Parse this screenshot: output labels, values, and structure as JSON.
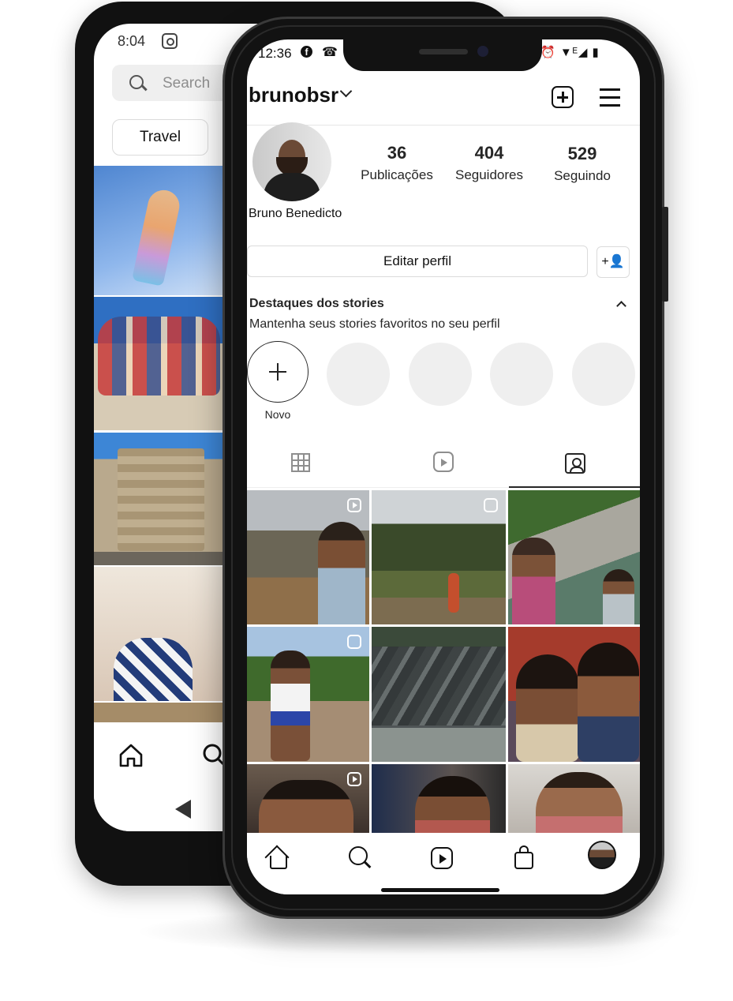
{
  "back_phone": {
    "time": "8:04",
    "search_placeholder": "Search",
    "chip_label": "Travel"
  },
  "status_bar": {
    "time": "12:36",
    "fb_glyph": "f",
    "right": "⏰ ▼ᴱ◢ ▮"
  },
  "profile": {
    "username": "brunobsr",
    "full_name": "Bruno Benedicto",
    "stats": [
      {
        "value": "36",
        "label": "Publicações"
      },
      {
        "value": "404",
        "label": "Seguidores"
      },
      {
        "value": "529",
        "label": "Seguindo"
      }
    ],
    "edit_label": "Editar perfil",
    "suggest_glyph": "+👤"
  },
  "highlights": {
    "title": "Destaques dos stories",
    "subtitle": "Mantenha seus stories favoritos no seu perfil",
    "new_label": "Novo"
  },
  "tabs": [
    {
      "icon": "grid-icon",
      "active": false
    },
    {
      "icon": "reels-icon",
      "active": false
    },
    {
      "icon": "tagged-icon",
      "active": true
    }
  ],
  "posts": [
    {
      "badge": "reel"
    },
    {
      "badge": "carousel"
    },
    {
      "badge": "none"
    },
    {
      "badge": "carousel"
    },
    {
      "badge": "none"
    },
    {
      "badge": "none"
    },
    {
      "badge": "reel"
    },
    {
      "badge": "none"
    },
    {
      "badge": "none"
    }
  ],
  "bottom_nav": [
    "home-icon",
    "search-icon",
    "reels-icon",
    "shop-icon",
    "profile-avatar"
  ]
}
